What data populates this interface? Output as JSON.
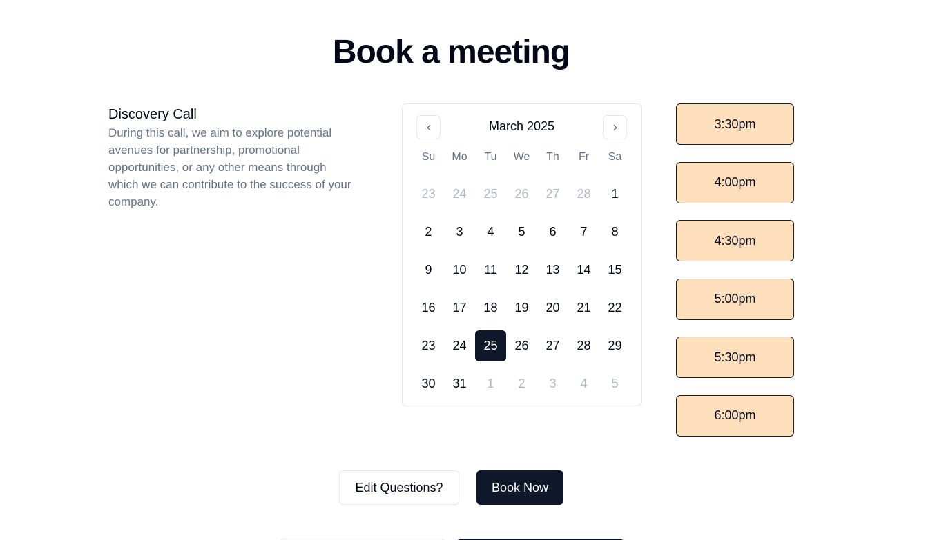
{
  "page": {
    "title": "Book a meeting"
  },
  "event": {
    "name": "Discovery Call",
    "description": "During this call, we aim to explore potential avenues for partnership, promotional opportunities, or any other means through which we can contribute to the success of your company."
  },
  "calendar": {
    "month_label": "March 2025",
    "prev_icon": "chevron-left-icon",
    "next_icon": "chevron-right-icon",
    "weekdays": [
      "Su",
      "Mo",
      "Tu",
      "We",
      "Th",
      "Fr",
      "Sa"
    ],
    "selected_day": "25",
    "weeks": [
      [
        {
          "d": "23",
          "out": true
        },
        {
          "d": "24",
          "out": true
        },
        {
          "d": "25",
          "out": true
        },
        {
          "d": "26",
          "out": true
        },
        {
          "d": "27",
          "out": true
        },
        {
          "d": "28",
          "out": true
        },
        {
          "d": "1",
          "out": false
        }
      ],
      [
        {
          "d": "2",
          "out": false
        },
        {
          "d": "3",
          "out": false
        },
        {
          "d": "4",
          "out": false
        },
        {
          "d": "5",
          "out": false
        },
        {
          "d": "6",
          "out": false
        },
        {
          "d": "7",
          "out": false
        },
        {
          "d": "8",
          "out": false
        }
      ],
      [
        {
          "d": "9",
          "out": false
        },
        {
          "d": "10",
          "out": false
        },
        {
          "d": "11",
          "out": false
        },
        {
          "d": "12",
          "out": false
        },
        {
          "d": "13",
          "out": false
        },
        {
          "d": "14",
          "out": false
        },
        {
          "d": "15",
          "out": false
        }
      ],
      [
        {
          "d": "16",
          "out": false
        },
        {
          "d": "17",
          "out": false
        },
        {
          "d": "18",
          "out": false
        },
        {
          "d": "19",
          "out": false
        },
        {
          "d": "20",
          "out": false
        },
        {
          "d": "21",
          "out": false
        },
        {
          "d": "22",
          "out": false
        }
      ],
      [
        {
          "d": "23",
          "out": false
        },
        {
          "d": "24",
          "out": false
        },
        {
          "d": "25",
          "out": false,
          "selected": true
        },
        {
          "d": "26",
          "out": false
        },
        {
          "d": "27",
          "out": false
        },
        {
          "d": "28",
          "out": false
        },
        {
          "d": "29",
          "out": false
        }
      ],
      [
        {
          "d": "30",
          "out": false
        },
        {
          "d": "31",
          "out": false
        },
        {
          "d": "1",
          "out": true
        },
        {
          "d": "2",
          "out": true
        },
        {
          "d": "3",
          "out": true
        },
        {
          "d": "4",
          "out": true
        },
        {
          "d": "5",
          "out": true
        }
      ]
    ]
  },
  "time_slots": [
    "3:30pm",
    "4:00pm",
    "4:30pm",
    "5:00pm",
    "5:30pm",
    "6:00pm"
  ],
  "actions": {
    "edit_label": "Edit Questions?",
    "book_label": "Book Now"
  },
  "colors": {
    "slot_bg": "#fddfbb",
    "primary": "#0f172a",
    "muted_text": "#64748b"
  }
}
